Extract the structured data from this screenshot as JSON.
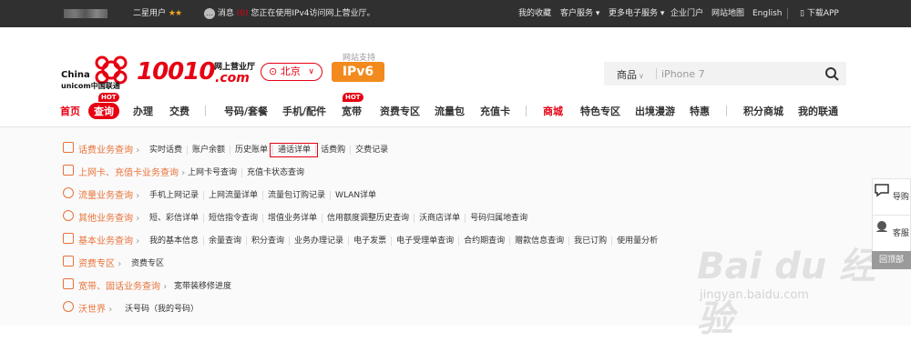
{
  "topbar": {
    "user_level": "二星用户",
    "stars": "★★",
    "msg_label": "消息",
    "msg_count": "(0)",
    "ipv4_notice": "您正在使用IPv4访问网上营业厅。",
    "links": [
      "我的收藏",
      "客户服务",
      "更多电子服务",
      "企业门户",
      "网站地图",
      "English"
    ],
    "download": "下载APP"
  },
  "header": {
    "brand_cn": "China",
    "brand_cn2": "unicom中国联通",
    "logo_number": "10010",
    "logo_hall": "网上营业厅",
    "logo_domain": ".com",
    "city": "北京",
    "ipv6_caption": "网站支持",
    "ipv6": "IPv6",
    "search_category": "商品",
    "search_placeholder": "iPhone 7"
  },
  "nav": {
    "items": [
      "首页",
      "查询",
      "办理",
      "交费",
      "号码/套餐",
      "手机/配件",
      "宽带",
      "资费专区",
      "流量包",
      "充值卡",
      "商城",
      "特色专区",
      "出境漫游",
      "特惠",
      "积分商城",
      "我的联通"
    ],
    "hot": "HOT"
  },
  "query_rows": [
    {
      "category": "话费业务查询",
      "links": [
        "实时话费",
        "账户余额",
        "历史账单",
        "通话详单",
        "话费购",
        "交费记录"
      ]
    },
    {
      "category": "上网卡、充值卡业务查询",
      "links": [
        "上网卡号查询",
        "充值卡状态查询"
      ]
    },
    {
      "category": "流量业务查询",
      "links": [
        "手机上网记录",
        "上网流量详单",
        "流量包订购记录",
        "WLAN详单"
      ]
    },
    {
      "category": "其他业务查询",
      "links": [
        "短、彩信详单",
        "短信指令查询",
        "增值业务详单",
        "信用额度调整历史查询",
        "沃商店详单",
        "号码归属地查询"
      ]
    },
    {
      "category": "基本业务查询",
      "links": [
        "我的基本信息",
        "余量查询",
        "积分查询",
        "业务办理记录",
        "电子发票",
        "电子受理单查询",
        "合约期查询",
        "赠款信息查询",
        "我已订购",
        "使用量分析"
      ]
    },
    {
      "category": "资费专区",
      "links": [
        "资费专区"
      ]
    },
    {
      "category": "宽带、固话业务查询",
      "links": [
        "宽带装移修进度"
      ]
    },
    {
      "category": "沃世界",
      "links": [
        "沃号码（我的号码）"
      ]
    }
  ],
  "side": {
    "guide": "导购",
    "service": "客服",
    "top": "回顶部"
  },
  "watermark": {
    "brand": "Bai du 经验",
    "url": "jingyan.baidu.com"
  },
  "colors": {
    "accent": "#e60012",
    "category": "#e8733a",
    "topbar": "#303030"
  }
}
